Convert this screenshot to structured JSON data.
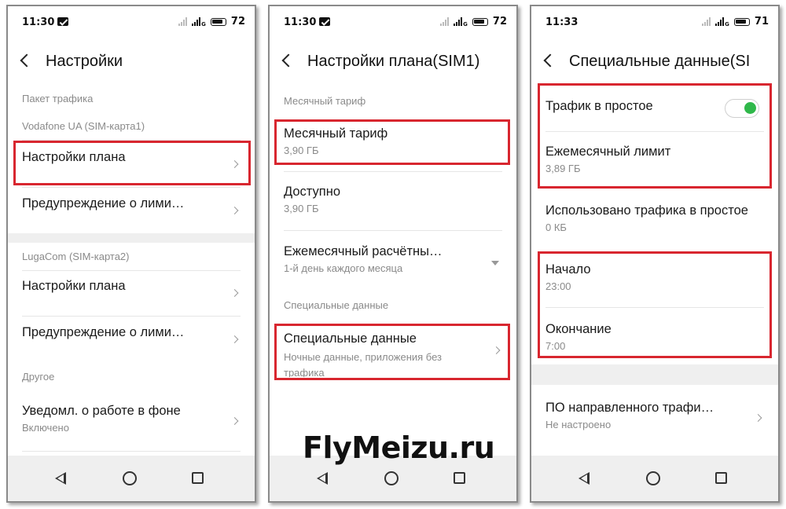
{
  "phone1": {
    "status": {
      "time": "11:30",
      "battery": "72"
    },
    "title": "Настройки",
    "sections": {
      "traffic": "Пакет трафика",
      "sim1": "Vodafone UA (SIM-карта1)",
      "sim2": "LugaCom (SIM-карта2)",
      "other": "Другое"
    },
    "items": {
      "plan1": "Настройки плана",
      "warn1": "Предупреждение о лими…",
      "plan2": "Настройки плана",
      "warn2": "Предупреждение о лими…",
      "background": "Уведомл. о работе в фоне",
      "background_sub": "Включено"
    }
  },
  "phone2": {
    "status": {
      "time": "11:30",
      "battery": "72"
    },
    "title": "Настройки плана(SIM1)",
    "sections": {
      "monthly": "Месячный тариф",
      "special": "Специальные данные"
    },
    "items": {
      "monthly": "Месячный тариф",
      "monthly_sub": "3,90 ГБ",
      "available": "Доступно",
      "available_sub": "3,90 ГБ",
      "billing": "Ежемесячный расчётны…",
      "billing_sub": "1-й день каждого месяца",
      "special": "Специальные данные",
      "special_sub": "Ночные данные, приложения без трафика"
    }
  },
  "phone3": {
    "status": {
      "time": "11:33",
      "battery": "71"
    },
    "title": "Специальные данные(SI",
    "items": {
      "idle_traffic": "Трафик в простое",
      "idle_traffic_on": true,
      "monthly_limit": "Ежемесячный лимит",
      "monthly_limit_sub": "3,89 ГБ",
      "idle_used": "Использовано трафика в простое",
      "idle_used_sub": "0 КБ",
      "start": "Начало",
      "start_sub": "23:00",
      "end": "Окончание",
      "end_sub": "7:00",
      "directed": "ПО направленного трафи…",
      "directed_sub": "Не настроено"
    }
  },
  "watermark": "FlyMeizu.ru",
  "colors": {
    "highlight": "#d8262f",
    "toggle_on": "#2fb84a"
  }
}
